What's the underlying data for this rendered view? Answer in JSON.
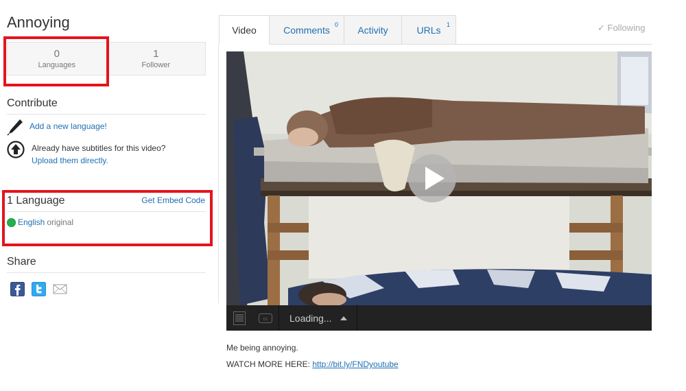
{
  "page": {
    "title": "Annoying"
  },
  "stats": [
    {
      "value": "0",
      "label": "Languages"
    },
    {
      "value": "1",
      "label": "Follower"
    }
  ],
  "contribute": {
    "heading": "Contribute",
    "add_language_link": "Add a new language!",
    "upload_prompt": "Already have subtitles for this video?",
    "upload_link": "Upload them directly."
  },
  "languages": {
    "heading": "1 Language",
    "embed_link": "Get Embed Code",
    "items": [
      {
        "name": "English",
        "note": "original",
        "status_color": "#23b14d"
      }
    ]
  },
  "share": {
    "heading": "Share",
    "icons": [
      "facebook-icon",
      "twitter-icon",
      "email-icon"
    ]
  },
  "tabs": [
    {
      "label": "Video",
      "badge": "",
      "active": true
    },
    {
      "label": "Comments",
      "badge": "0",
      "active": false
    },
    {
      "label": "Activity",
      "badge": "",
      "active": false
    },
    {
      "label": "URLs",
      "badge": "1",
      "active": false
    }
  ],
  "follow": {
    "label": "✓ Following"
  },
  "player": {
    "status": "Loading...",
    "icons": [
      "transcript-icon",
      "closed-captions-icon",
      "play-icon",
      "caret-up-icon"
    ]
  },
  "description": {
    "line1": "Me being annoying.",
    "line2_prefix": "WATCH MORE HERE: ",
    "line2_link": "http://bit.ly/FNDyoutube"
  },
  "colors": {
    "highlight": "#e3141e",
    "link": "#1f6fb2",
    "player_bar": "#222222"
  }
}
